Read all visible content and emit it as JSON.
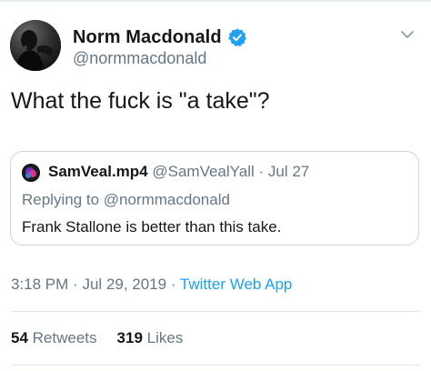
{
  "tweet": {
    "author": {
      "name": "Norm Macdonald",
      "handle": "@normmacdonald",
      "verified": true,
      "avatar_icon": "profile-photo-silhouette"
    },
    "text": "What the fuck is \"a take\"?",
    "quoted": {
      "name": "SamVeal.mp4",
      "handle": "@SamVealYall",
      "separator": "·",
      "date": "Jul 27",
      "replying_to": "Replying to @normmacdonald",
      "text": "Frank Stallone is better than this take."
    },
    "meta": {
      "time": "3:18 PM",
      "separator": "·",
      "date": "Jul 29, 2019",
      "source": "Twitter Web App"
    },
    "stats": {
      "retweets_count": "54",
      "retweets_label": "Retweets",
      "likes_count": "319",
      "likes_label": "Likes"
    }
  },
  "colors": {
    "text": "#14171a",
    "secondary": "#657786",
    "accent": "#1da1f2",
    "border": "#ccd6dd"
  },
  "icons": {
    "verified": "verified-badge-icon",
    "more": "chevron-down-icon"
  }
}
